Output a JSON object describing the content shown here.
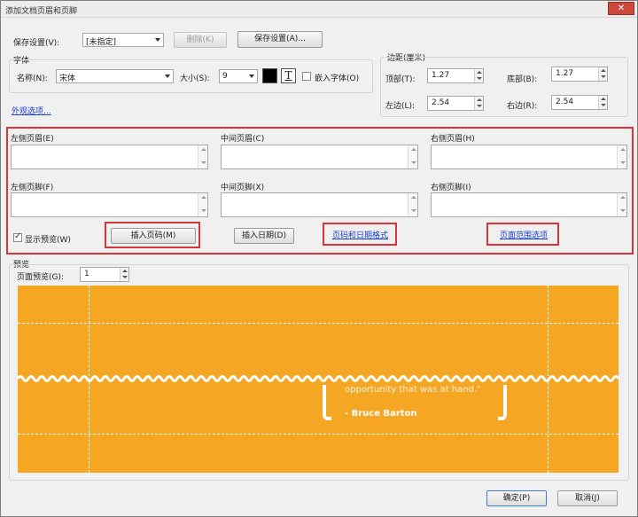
{
  "window": {
    "title": "添加文档页眉和页脚",
    "close_label": "✕"
  },
  "saved_settings": {
    "label": "保存设置(V):",
    "value": "[未指定]",
    "delete_label": "删除(K)",
    "save_label": "保存设置(A)..."
  },
  "font": {
    "group_label": "字体",
    "name_label": "名称(N):",
    "name_value": "宋体",
    "size_label": "大小(S):",
    "size_value": "9",
    "color": "#000000",
    "text_style_glyph": "T",
    "embed_label": "嵌入字体(O)"
  },
  "appearance_link": "外观选项...",
  "margins": {
    "group_label": "边距(厘米)",
    "top_label": "顶部(T):",
    "top_value": "1.27",
    "bottom_label": "底部(B):",
    "bottom_value": "1.27",
    "left_label": "左边(L):",
    "left_value": "2.54",
    "right_label": "右边(R):",
    "right_value": "2.54"
  },
  "header_footer": {
    "left_header": "左侧页眉(E)",
    "center_header": "中间页眉(C)",
    "right_header": "右侧页眉(H)",
    "left_footer": "左侧页脚(F)",
    "center_footer": "中间页脚(X)",
    "right_footer": "右侧页脚(I)"
  },
  "show_preview_label": "显示预览(W)",
  "insert_page_number": "插入页码(M)",
  "insert_date": "插入日期(D)",
  "page_number_date_format": "页码和日期格式",
  "page_range_options": "页面范围选项",
  "preview": {
    "group_label": "预览",
    "page_label": "页面预览(G):",
    "page_value": "1",
    "quote_text": "opportunity that was at hand.\"",
    "quote_author": "- Bruce Barton",
    "background_color": "#f5a623"
  },
  "ok_label": "确定(P)",
  "cancel_label": "取消(J)"
}
